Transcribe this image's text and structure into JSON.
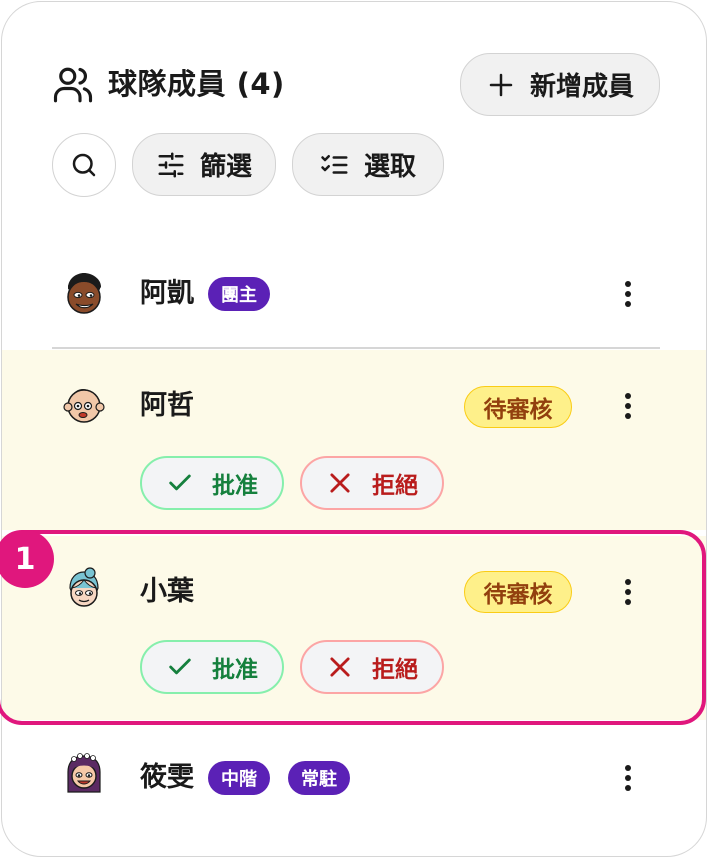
{
  "header": {
    "title": "球隊成員 (4)",
    "add_label": "新增成員"
  },
  "toolbar": {
    "filter_label": "篩選",
    "select_label": "選取"
  },
  "members": [
    {
      "name": "阿凱",
      "badges": [
        "團主"
      ]
    },
    {
      "name": "阿哲",
      "status": "待審核",
      "approve_label": "批准",
      "reject_label": "拒絕"
    },
    {
      "name": "小葉",
      "status": "待審核",
      "approve_label": "批准",
      "reject_label": "拒絕"
    },
    {
      "name": "筱雯",
      "badges": [
        "中階",
        "常駐"
      ]
    }
  ],
  "annotation": {
    "marker": "1"
  },
  "colors": {
    "badge": "#5b21b6",
    "pending_bg": "#fdfae8",
    "pending_badge": "#fef08a",
    "approve": "#15803d",
    "reject": "#b91c1c",
    "highlight": "#e0177d"
  },
  "icons": {
    "header": "users-icon",
    "add": "plus-icon",
    "search": "search-icon",
    "filter": "sliders-icon",
    "select": "checklist-icon",
    "more": "more-vertical-icon"
  }
}
